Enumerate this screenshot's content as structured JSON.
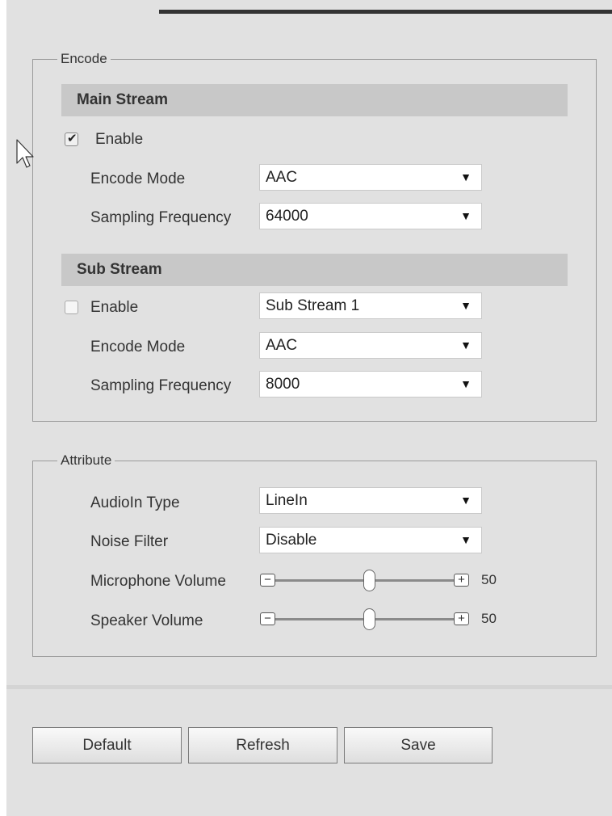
{
  "encode": {
    "legend": "Encode",
    "main_stream": {
      "title": "Main Stream",
      "enable_label": "Enable",
      "enabled": true,
      "encode_mode_label": "Encode Mode",
      "encode_mode_value": "AAC",
      "sampling_label": "Sampling Frequency",
      "sampling_value": "64000"
    },
    "sub_stream": {
      "title": "Sub Stream",
      "enable_label": "Enable",
      "enabled": false,
      "stream_value": "Sub Stream 1",
      "encode_mode_label": "Encode Mode",
      "encode_mode_value": "AAC",
      "sampling_label": "Sampling Frequency",
      "sampling_value": "8000"
    }
  },
  "attribute": {
    "legend": "Attribute",
    "audioin_type_label": "AudioIn Type",
    "audioin_type_value": "LineIn",
    "noise_filter_label": "Noise Filter",
    "noise_filter_value": "Disable",
    "mic_volume_label": "Microphone Volume",
    "mic_volume_value": "50",
    "speaker_volume_label": "Speaker Volume",
    "speaker_volume_value": "50",
    "minus_symbol": "−",
    "plus_symbol": "+"
  },
  "buttons": {
    "default": "Default",
    "refresh": "Refresh",
    "save": "Save"
  },
  "icons": {
    "dropdown": "▼",
    "checkmark": "✔"
  }
}
